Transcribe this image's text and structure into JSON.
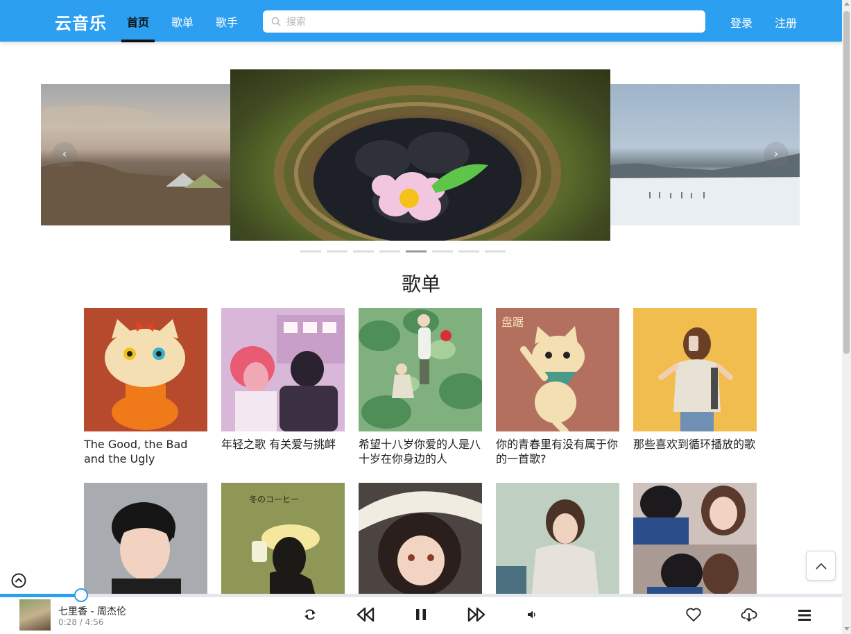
{
  "header": {
    "logo": "云音乐",
    "nav": [
      "首页",
      "歌单",
      "歌手"
    ],
    "search_placeholder": "搜索",
    "login": "登录",
    "register": "注册"
  },
  "carousel": {
    "prev_symbol": "‹",
    "next_symbol": "›",
    "dot_count": 8,
    "active_dot": 4
  },
  "section": {
    "title": "歌单"
  },
  "playlists": [
    {
      "title": "The Good, the Bad and the Ugly"
    },
    {
      "title": "年轻之歌 有关爱与挑衅"
    },
    {
      "title": "希望十八岁你爱的人是八十岁在你身边的人"
    },
    {
      "title": "你的青春里有没有属于你的一首歌?"
    },
    {
      "title": "那些喜欢到循环播放的歌"
    },
    {
      "title": ""
    },
    {
      "title": ""
    },
    {
      "title": ""
    },
    {
      "title": ""
    },
    {
      "title": ""
    }
  ],
  "cover_art": {
    "card2_text": "冬のコーヒー",
    "card4_text": "盘踞"
  },
  "player": {
    "song": "七里香 - 周杰伦",
    "time": "0:28 / 4:56",
    "progress": 0.096,
    "accent": "#2d9ff0"
  }
}
